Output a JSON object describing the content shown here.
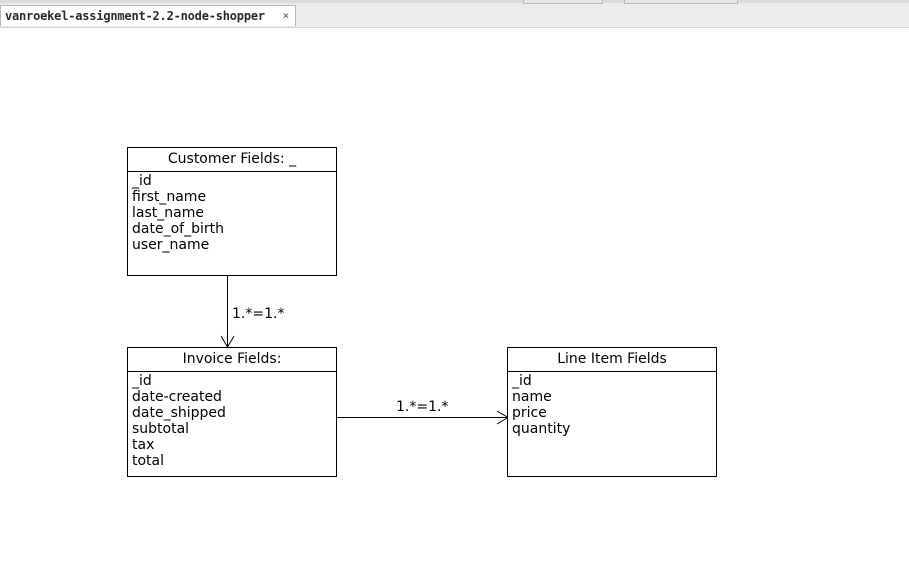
{
  "tab": {
    "title": "vanroekel-assignment-2.2-node-shopper",
    "close_label": "×"
  },
  "classes": {
    "customer": {
      "title": "Customer Fields: _",
      "fields": [
        "_id",
        "first_name",
        "last_name",
        "date_of_birth",
        "user_name"
      ]
    },
    "invoice": {
      "title": "Invoice Fields:",
      "fields": [
        "_id",
        "date-created",
        "date_shipped",
        "subtotal",
        "tax",
        "total"
      ]
    },
    "lineitem": {
      "title": "Line Item Fields",
      "fields": [
        "_id",
        "name",
        "price",
        "quantity"
      ]
    }
  },
  "associations": {
    "customer_invoice": "1.*=1.*",
    "invoice_lineitem": "1.*=1.*"
  },
  "colors": {
    "line": "#000000",
    "tab_bar": "#ececec"
  }
}
